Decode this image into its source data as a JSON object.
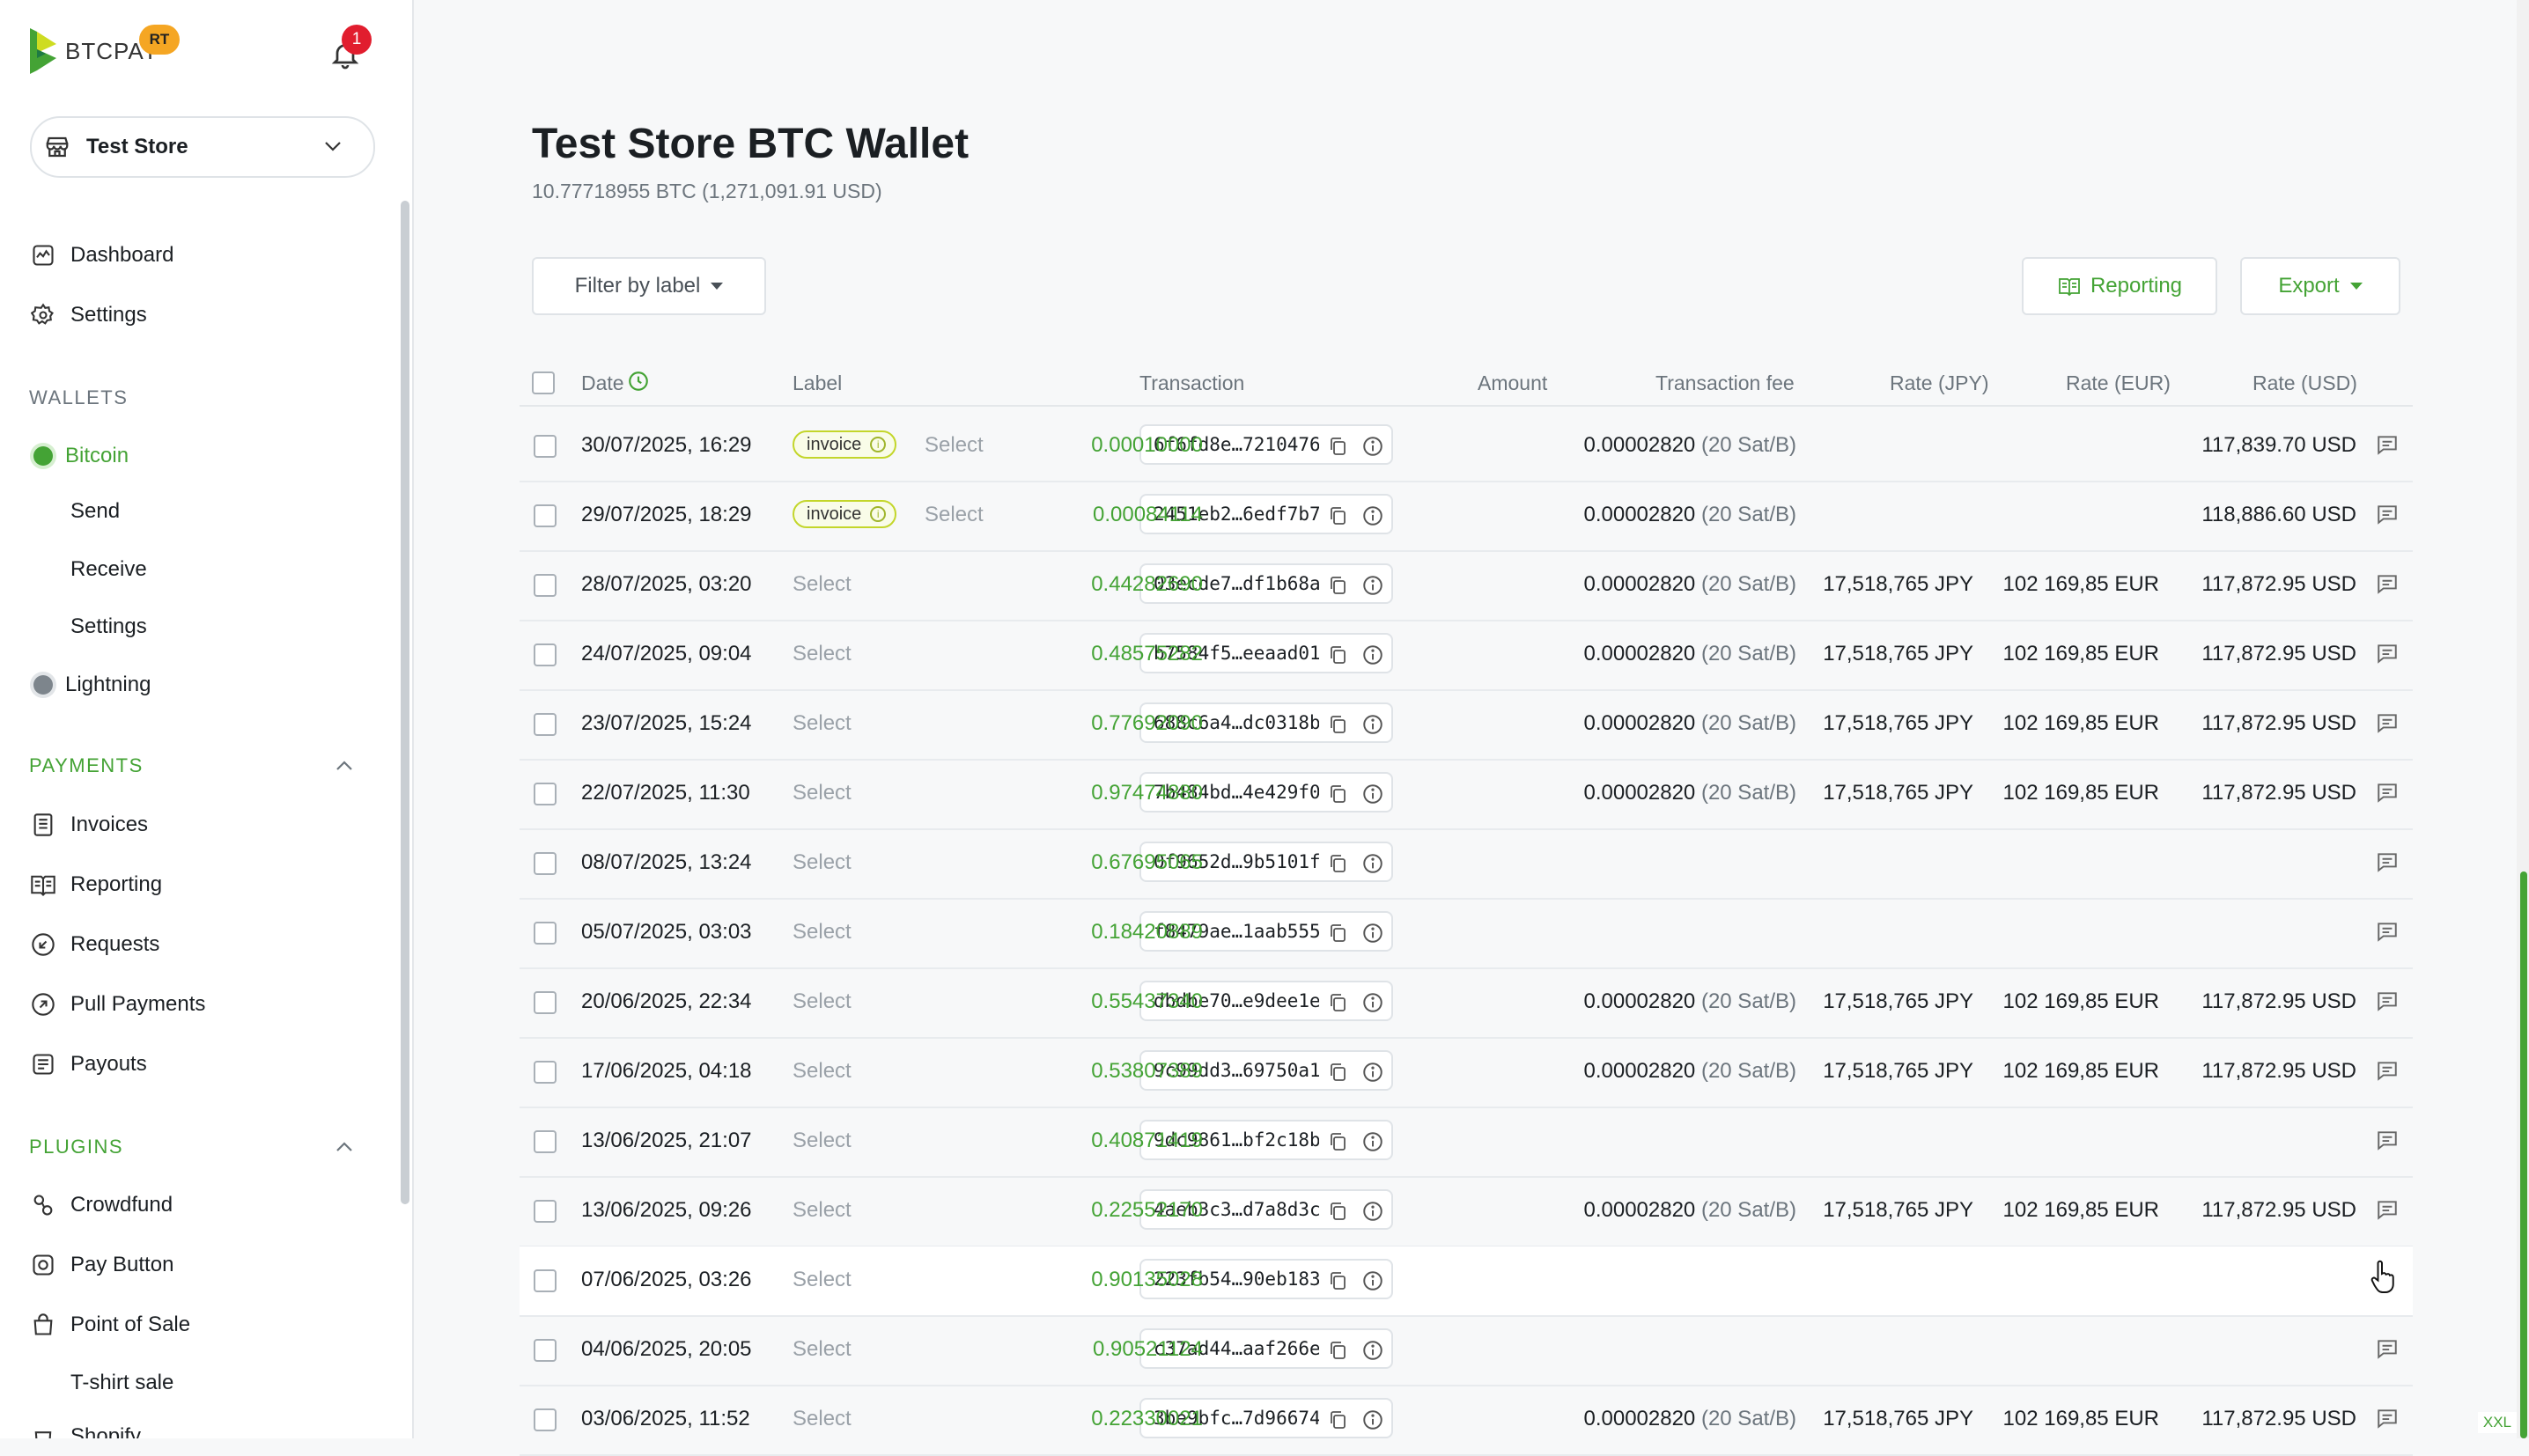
{
  "sidebar": {
    "logo_text": "BTCPAY",
    "logo_badge": "RT",
    "notifications_count": "1",
    "store_name": "Test Store",
    "dashboard": "Dashboard",
    "settings": "Settings",
    "wallets_header": "WALLETS",
    "bitcoin": "Bitcoin",
    "send": "Send",
    "receive": "Receive",
    "wallet_settings": "Settings",
    "lightning": "Lightning",
    "payments_header": "PAYMENTS",
    "invoices": "Invoices",
    "reporting": "Reporting",
    "requests": "Requests",
    "pull_payments": "Pull Payments",
    "payouts": "Payouts",
    "plugins_header": "PLUGINS",
    "crowdfund": "Crowdfund",
    "pay_button": "Pay Button",
    "point_of_sale": "Point of Sale",
    "tshirt_sale": "T-shirt sale",
    "partial_item": "Shopify"
  },
  "header": {
    "title": "Test Store BTC Wallet",
    "balance": "10.77718955 BTC (1,271,091.91 USD)",
    "filter_label": "Filter by label",
    "reporting_label": "Reporting",
    "export_label": "Export"
  },
  "table": {
    "columns": {
      "date": "Date",
      "label": "Label",
      "transaction": "Transaction",
      "amount": "Amount",
      "fee": "Transaction fee",
      "rate_jpy": "Rate (JPY)",
      "rate_eur": "Rate (EUR)",
      "rate_usd": "Rate (USD)"
    },
    "rows": [
      {
        "date": "30/07/2025, 16:29",
        "badge": "invoice",
        "select": "Select",
        "tx": "6f6fd8e…7210476",
        "amount": "0.00010000",
        "fee": "0.00002820",
        "fee_rate": "(20 Sat/B)",
        "jpy": "",
        "eur": "",
        "usd": "117,839.70 USD"
      },
      {
        "date": "29/07/2025, 18:29",
        "badge": "invoice",
        "select": "Select",
        "tx": "2451eb2…6edf7b7",
        "amount": "0.00084114",
        "fee": "0.00002820",
        "fee_rate": "(20 Sat/B)",
        "jpy": "",
        "eur": "",
        "usd": "118,886.60 USD"
      },
      {
        "date": "28/07/2025, 03:20",
        "badge": "",
        "select": "Select",
        "tx": "03ecde7…df1b68a",
        "amount": "0.44282690",
        "fee": "0.00002820",
        "fee_rate": "(20 Sat/B)",
        "jpy": "17,518,765 JPY",
        "eur": "102 169,85 EUR",
        "usd": "117,872.95 USD"
      },
      {
        "date": "24/07/2025, 09:04",
        "badge": "",
        "select": "Select",
        "tx": "b7584f5…eeaad01",
        "amount": "0.48575282",
        "fee": "0.00002820",
        "fee_rate": "(20 Sat/B)",
        "jpy": "17,518,765 JPY",
        "eur": "102 169,85 EUR",
        "usd": "117,872.95 USD"
      },
      {
        "date": "23/07/2025, 15:24",
        "badge": "",
        "select": "Select",
        "tx": "688c6a4…dc0318b",
        "amount": "0.77692090",
        "fee": "0.00002820",
        "fee_rate": "(20 Sat/B)",
        "jpy": "17,518,765 JPY",
        "eur": "102 169,85 EUR",
        "usd": "117,872.95 USD"
      },
      {
        "date": "22/07/2025, 11:30",
        "badge": "",
        "select": "Select",
        "tx": "7b484bd…4e429f0",
        "amount": "0.97474880",
        "fee": "0.00002820",
        "fee_rate": "(20 Sat/B)",
        "jpy": "17,518,765 JPY",
        "eur": "102 169,85 EUR",
        "usd": "117,872.95 USD"
      },
      {
        "date": "08/07/2025, 13:24",
        "badge": "",
        "select": "Select",
        "tx": "0f9652d…9b5101f",
        "amount": "0.67695065",
        "fee": "",
        "fee_rate": "",
        "jpy": "",
        "eur": "",
        "usd": ""
      },
      {
        "date": "05/07/2025, 03:03",
        "badge": "",
        "select": "Select",
        "tx": "f8479ae…1aab555",
        "amount": "0.18420889",
        "fee": "",
        "fee_rate": "",
        "jpy": "",
        "eur": "",
        "usd": ""
      },
      {
        "date": "20/06/2025, 22:34",
        "badge": "",
        "select": "Select",
        "tx": "dbdbe70…e9dee1e",
        "amount": "0.55437340",
        "fee": "0.00002820",
        "fee_rate": "(20 Sat/B)",
        "jpy": "17,518,765 JPY",
        "eur": "102 169,85 EUR",
        "usd": "117,872.95 USD"
      },
      {
        "date": "17/06/2025, 04:18",
        "badge": "",
        "select": "Select",
        "tx": "9c99dd3…69750a1",
        "amount": "0.53807389",
        "fee": "0.00002820",
        "fee_rate": "(20 Sat/B)",
        "jpy": "17,518,765 JPY",
        "eur": "102 169,85 EUR",
        "usd": "117,872.95 USD"
      },
      {
        "date": "13/06/2025, 21:07",
        "badge": "",
        "select": "Select",
        "tx": "9dc9861…bf2c18b",
        "amount": "0.40871419",
        "fee": "",
        "fee_rate": "",
        "jpy": "",
        "eur": "",
        "usd": ""
      },
      {
        "date": "13/06/2025, 09:26",
        "badge": "",
        "select": "Select",
        "tx": "4aeb3c3…d7a8d3c",
        "amount": "0.22552170",
        "fee": "0.00002820",
        "fee_rate": "(20 Sat/B)",
        "jpy": "17,518,765 JPY",
        "eur": "102 169,85 EUR",
        "usd": "117,872.95 USD"
      },
      {
        "date": "07/06/2025, 03:26",
        "badge": "",
        "select": "Select",
        "tx": "223fb54…90eb183",
        "amount": "0.90135028",
        "fee": "",
        "fee_rate": "",
        "jpy": "",
        "eur": "",
        "usd": ""
      },
      {
        "date": "04/06/2025, 20:05",
        "badge": "",
        "select": "Select",
        "tx": "c37ad44…aaf266e",
        "amount": "0.90521124",
        "fee": "",
        "fee_rate": "",
        "jpy": "",
        "eur": "",
        "usd": ""
      },
      {
        "date": "03/06/2025, 11:52",
        "badge": "",
        "select": "Select",
        "tx": "3be9bfc…7d96674",
        "amount": "0.22330021",
        "fee": "0.00002820",
        "fee_rate": "(20 Sat/B)",
        "jpy": "17,518,765 JPY",
        "eur": "102 169,85 EUR",
        "usd": "117,872.95 USD"
      }
    ]
  },
  "screen_badge": "XXL",
  "colors": {
    "accent": "#44a335",
    "badge_border": "#c3d62a",
    "notification": "#e11d2e",
    "logo_badge": "#f5a623"
  }
}
